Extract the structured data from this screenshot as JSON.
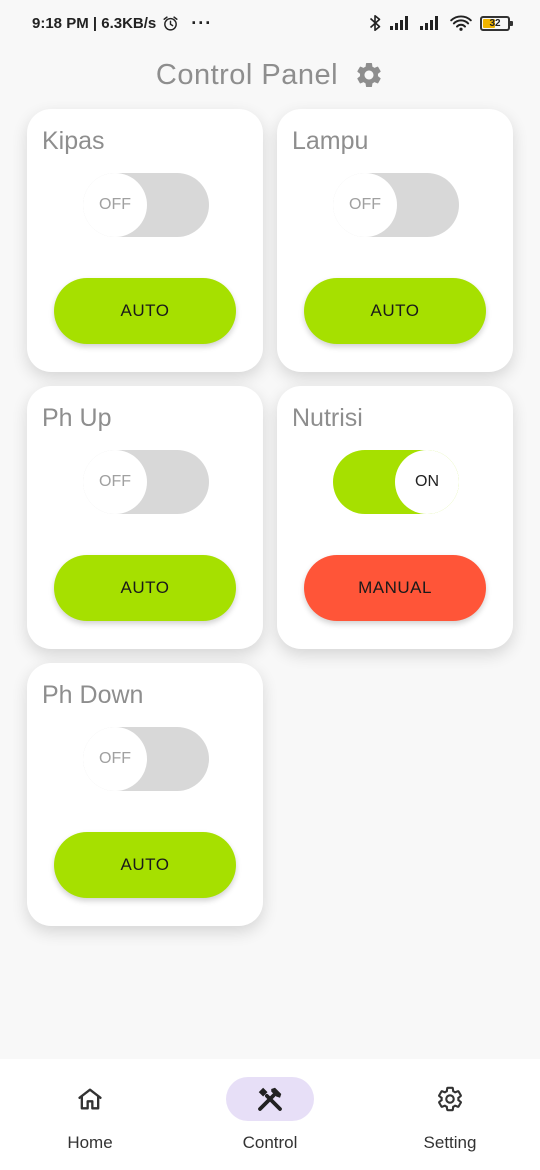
{
  "status_bar": {
    "time_speed": "9:18 PM | 6.3KB/s",
    "more": "···",
    "battery": "32"
  },
  "header": {
    "title": "Control Panel",
    "icon": "gear-icon"
  },
  "cards": [
    {
      "title": "Kipas",
      "state": "OFF",
      "mode": "AUTO"
    },
    {
      "title": "Lampu",
      "state": "OFF",
      "mode": "AUTO"
    },
    {
      "title": "Ph Up",
      "state": "OFF",
      "mode": "AUTO"
    },
    {
      "title": "Nutrisi",
      "state": "ON",
      "mode": "MANUAL"
    },
    {
      "title": "Ph Down",
      "state": "OFF",
      "mode": "AUTO"
    }
  ],
  "colors": {
    "accent_green": "#a6e000",
    "manual_red": "#ff5538",
    "toggle_off": "#d8d8d8",
    "nav_active_pill": "#e7dff7"
  },
  "bottom_nav": {
    "items": [
      {
        "label": "Home",
        "icon": "home-icon"
      },
      {
        "label": "Control",
        "icon": "tools-icon",
        "active": true
      },
      {
        "label": "Setting",
        "icon": "gear-icon"
      }
    ]
  }
}
